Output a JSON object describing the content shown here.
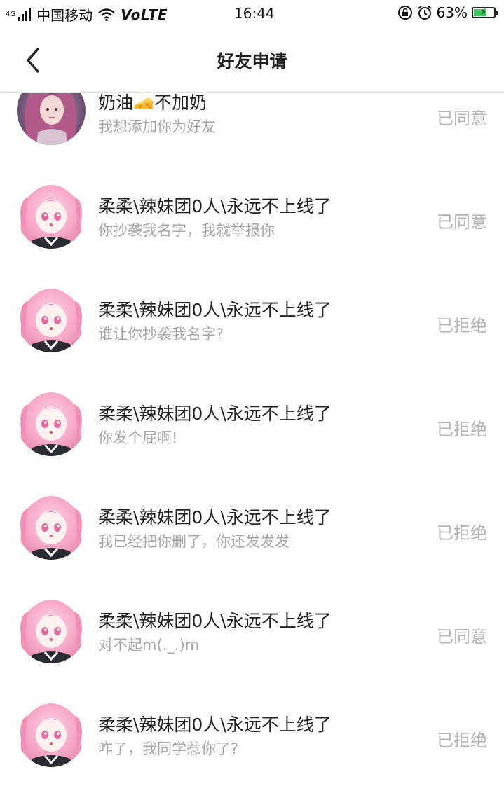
{
  "status_bar": {
    "network": "4G",
    "carrier": "中国移动",
    "volte": "VoLTE",
    "time": "16:44",
    "battery": "63%",
    "battery_level": 0.63,
    "icons": [
      "signal-icon",
      "wifi-icon",
      "lock-rotation-icon",
      "alarm-icon",
      "battery-icon"
    ]
  },
  "nav": {
    "title": "好友申请",
    "back_icon": "back-arrow-icon"
  },
  "requests": [
    {
      "name_a": "奶油",
      "name_b": "不加奶",
      "emoji": "cheese-icon",
      "message": "我想添加你为好友",
      "status": "已同意"
    },
    {
      "name": "柔柔\\辣妹团0人\\永远不上线了",
      "message": "你抄袭我名字，我就举报你",
      "status": "已同意"
    },
    {
      "name": "柔柔\\辣妹团0人\\永远不上线了",
      "message": "谁让你抄袭我名字?",
      "status": "已拒绝"
    },
    {
      "name": "柔柔\\辣妹团0人\\永远不上线了",
      "message": "你发个屁啊!",
      "status": "已拒绝"
    },
    {
      "name": "柔柔\\辣妹团0人\\永远不上线了",
      "message": "我已经把你删了，你还发发发",
      "status": "已拒绝"
    },
    {
      "name": "柔柔\\辣妹团0人\\永远不上线了",
      "message": "对不起m(._.)m",
      "status": "已同意"
    },
    {
      "name": "柔柔\\辣妹团0人\\永远不上线了",
      "message": "咋了，我同学惹你了?",
      "status": "已拒绝"
    }
  ],
  "colors": {
    "status_text": "#b4b4b4",
    "message_text": "#a8a8a8",
    "battery_fill": "#3cc85a"
  }
}
